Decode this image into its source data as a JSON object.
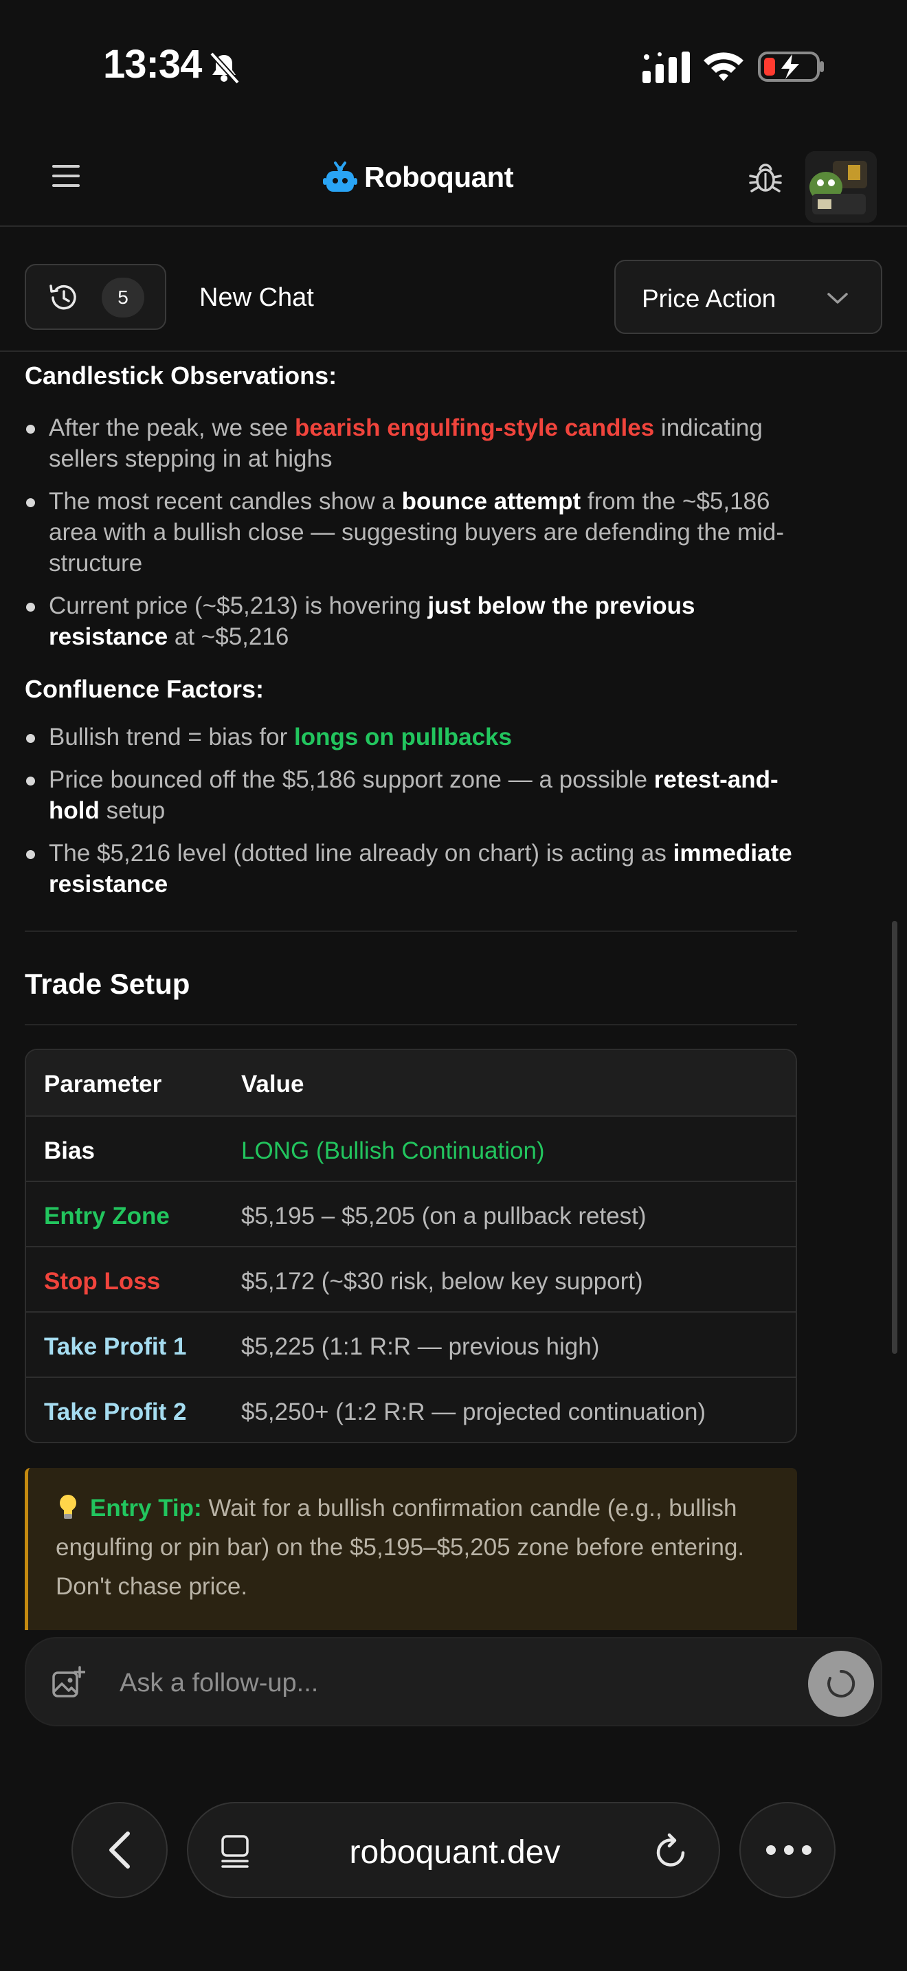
{
  "status_bar": {
    "time": "13:34"
  },
  "header": {
    "brand": "Roboquant"
  },
  "toolbar": {
    "history_count": "5",
    "new_chat_label": "New Chat",
    "mode_selected": "Price Action"
  },
  "message": {
    "candlestick_heading": "Candlestick Observations:",
    "candlestick_items": [
      [
        "After the peak, we see ",
        "bearish engulfing-style candles",
        " indicating sellers stepping in at highs"
      ],
      [
        "The most recent candles show a ",
        "bounce attempt",
        " from the ~$5,186 area with a bullish close — suggesting buyers are defending the mid-structure"
      ],
      [
        "Current price (~$5,213) is hovering ",
        "just below the previous resistance",
        " at ~$5,216"
      ]
    ],
    "confluence_heading": "Confluence Factors:",
    "confluence_items": [
      [
        "Bullish trend = bias for ",
        "longs on pullbacks",
        ""
      ],
      [
        "Price bounced off the $5,186 support zone — a possible ",
        "retest-and-hold",
        " setup"
      ],
      [
        "The $5,216 level (dotted line already on chart) is acting as ",
        "immediate resistance",
        ""
      ]
    ],
    "trade_setup_heading": "Trade Setup",
    "table": {
      "headers": [
        "Parameter",
        "Value"
      ],
      "rows": [
        {
          "parameter": "Bias",
          "value": "LONG (Bullish Continuation)"
        },
        {
          "parameter": "Entry Zone",
          "value": "$5,195 – $5,205 (on a pullback retest)"
        },
        {
          "parameter": "Stop Loss",
          "value": "$5,172 (~$30 risk, below key support)"
        },
        {
          "parameter": "Take Profit 1",
          "value": "$5,225 (1:1 R:R — previous high)"
        },
        {
          "parameter": "Take Profit 2",
          "value": "$5,250+ (1:2 R:R — projected continuation)"
        }
      ]
    },
    "tip": {
      "label": "Entry Tip:",
      "text": " Wait for a bullish confirmation candle (e.g., bullish engulfing or pin bar) on the $5,195–$5,205 zone before entering. Don't chase price."
    }
  },
  "composer": {
    "placeholder": "Ask a follow-up..."
  },
  "browser": {
    "url": "roboquant.dev"
  },
  "colors": {
    "background": "#111111",
    "bearish_red": "#f0443c",
    "bullish_green": "#22c55e",
    "take_profit_blue": "#a5dcf0",
    "brand_blue": "#2aa4f4",
    "tip_border": "#c58a10"
  },
  "icons": {
    "menu": "hamburger-icon",
    "logo": "robot-icon",
    "debug": "bug-icon",
    "history": "history-clock-icon",
    "dropdown": "chevron-down-icon",
    "tip": "lightbulb-icon",
    "attach": "image-plus-icon",
    "send": "loading-spinner-icon",
    "back": "chevron-left-icon",
    "tabs": "tabs-icon",
    "reload": "reload-icon",
    "more": "more-dots-icon"
  }
}
